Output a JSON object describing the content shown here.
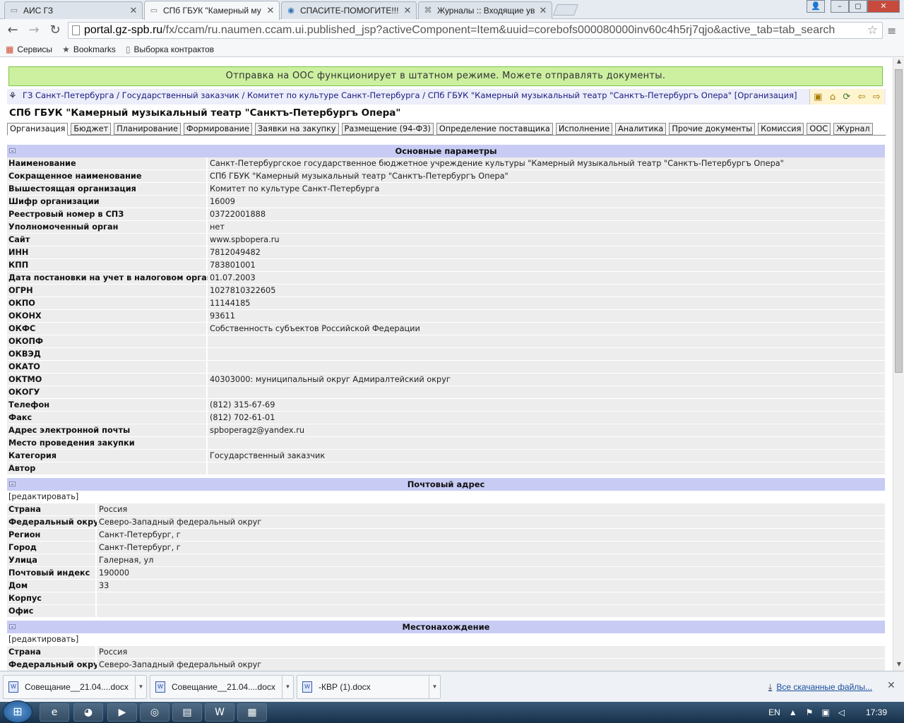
{
  "browser": {
    "tabs": [
      {
        "label": "АИС ГЗ",
        "icon": "page-icon"
      },
      {
        "label": "СПб ГБУК \"Камерный му",
        "icon": "page-icon"
      },
      {
        "label": "СПАСИТЕ-ПОМОГИТЕ!!!",
        "icon": "globe-icon"
      },
      {
        "label": "Журналы :: Входящие ув",
        "icon": "network-icon"
      }
    ],
    "window_buttons": {
      "user": "👤",
      "minimize": "–",
      "maximize": "◻",
      "close": "✕"
    },
    "url_host": "portal.gz-spb.ru",
    "url_path": "/fx/ccam/ru.naumen.ccam.ui.published_jsp?activeComponent=Item&uuid=corebofs000080000inv60c4h5rj7qjo&active_tab=tab_search",
    "bookmarks": [
      {
        "label": "Сервисы",
        "icon": "apps-grid-icon"
      },
      {
        "label": "Bookmarks",
        "icon": "star-icon"
      },
      {
        "label": "Выборка контрактов",
        "icon": "page-icon"
      }
    ]
  },
  "page": {
    "banner": "Отправка на ООС функционирует в штатном режиме. Можете отправлять документы.",
    "breadcrumb": "ГЗ Санкт-Петербурга / Государственный заказчик / Комитет по культуре Санкт-Петербурга / СПб ГБУК \"Камерный музыкальный театр \"Санктъ-Петербургъ Опера\" [Организация]",
    "title": "СПб ГБУК \"Камерный музыкальный театр \"Санктъ-Петербургъ Опера\"",
    "tabs": [
      "Организация",
      "Бюджет",
      "Планирование",
      "Формирование",
      "Заявки на закупку",
      "Размещение (94-ФЗ)",
      "Определение поставщика",
      "Исполнение",
      "Аналитика",
      "Прочие документы",
      "Комиссия",
      "ООС",
      "Журнал"
    ],
    "edit_link": "[редактировать]",
    "sections": {
      "main": {
        "title": "Основные параметры",
        "rows": [
          {
            "label": "Наименование",
            "value": "Санкт-Петербургское государственное бюджетное учреждение культуры \"Камерный музыкальный театр \"Санктъ-Петербургъ Опера\""
          },
          {
            "label": "Сокращенное наименование",
            "value": "СПб ГБУК \"Камерный музыкальный театр \"Санктъ-Петербургъ Опера\""
          },
          {
            "label": "Вышестоящая организация",
            "value": "Комитет по культуре Санкт-Петербурга"
          },
          {
            "label": "Шифр организации",
            "value": "16009"
          },
          {
            "label": "Реестровый номер в СПЗ",
            "value": "03722001888"
          },
          {
            "label": "Уполномоченный орган",
            "value": "нет"
          },
          {
            "label": "Сайт",
            "value": "www.spbopera.ru"
          },
          {
            "label": "ИНН",
            "value": "7812049482"
          },
          {
            "label": "КПП",
            "value": "783801001"
          },
          {
            "label": "Дата постановки на учет в налоговом органе",
            "value": "01.07.2003"
          },
          {
            "label": "ОГРН",
            "value": "1027810322605"
          },
          {
            "label": "ОКПО",
            "value": "11144185"
          },
          {
            "label": "ОКОНХ",
            "value": "93611"
          },
          {
            "label": "ОКФС",
            "value": "Собственность субъектов Российской Федерации"
          },
          {
            "label": "ОКОПФ",
            "value": ""
          },
          {
            "label": "ОКВЭД",
            "value": ""
          },
          {
            "label": "ОКАТО",
            "value": ""
          },
          {
            "label": "ОКТМО",
            "value": "40303000: муниципальный округ Адмиралтейский округ"
          },
          {
            "label": "ОКОГУ",
            "value": ""
          },
          {
            "label": "Телефон",
            "value": "(812) 315-67-69"
          },
          {
            "label": "Факс",
            "value": "(812) 702-61-01"
          },
          {
            "label": "Адрес электронной почты",
            "value": "spboperagz@yandex.ru"
          },
          {
            "label": "Место проведения закупки",
            "value": ""
          },
          {
            "label": "Категория",
            "value": "Государственный заказчик"
          },
          {
            "label": "Автор",
            "value": ""
          }
        ]
      },
      "postal": {
        "title": "Почтовый адрес",
        "rows": [
          {
            "label": "Страна",
            "value": "Россия"
          },
          {
            "label": "Федеральный округ",
            "value": "Северо-Западный федеральный округ"
          },
          {
            "label": "Регион",
            "value": "Санкт-Петербург, г"
          },
          {
            "label": "Город",
            "value": "Санкт-Петербург, г"
          },
          {
            "label": "Улица",
            "value": "Галерная, ул"
          },
          {
            "label": "Почтовый индекс",
            "value": "190000"
          },
          {
            "label": "Дом",
            "value": "33"
          },
          {
            "label": "Корпус",
            "value": ""
          },
          {
            "label": "Офис",
            "value": ""
          }
        ]
      },
      "location": {
        "title": "Местонахождение",
        "rows": [
          {
            "label": "Страна",
            "value": "Россия"
          },
          {
            "label": "Федеральный округ",
            "value": "Северо-Западный федеральный округ"
          }
        ]
      }
    }
  },
  "downloads": {
    "items": [
      "Совещание__21.04....docx",
      "Совещание__21.04....docx",
      "-КВР (1).docx"
    ],
    "show_all": "Все скачанные файлы..."
  },
  "taskbar": {
    "lang": "EN",
    "time": "17:39"
  }
}
